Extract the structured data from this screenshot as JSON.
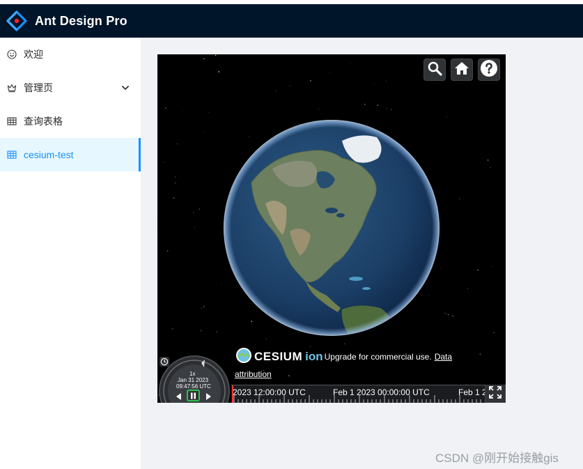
{
  "app": {
    "title": "Ant Design Pro"
  },
  "sidebar": {
    "items": [
      {
        "label": "欢迎",
        "icon": "smile-icon"
      },
      {
        "label": "管理页",
        "icon": "crown-icon",
        "expandable": true
      },
      {
        "label": "查询表格",
        "icon": "table-icon"
      },
      {
        "label": "cesium-test",
        "icon": "table-icon",
        "selected": true
      }
    ]
  },
  "viewer": {
    "toolbar": [
      "search-icon",
      "home-icon",
      "help-icon"
    ],
    "credit": {
      "brand_main": "CESIUM",
      "brand_sub": "ion",
      "upgrade_text": "Upgrade for commercial use.",
      "data_link": "Data",
      "attribution_link": "attribution"
    },
    "animation": {
      "speed": "1x",
      "date": "Jan 31 2023",
      "time": "09:47:56 UTC"
    },
    "timeline": {
      "labels": [
        "2023 12:00:00 UTC",
        "Feb 1 2023 00:00:00 UTC",
        "Feb 1 2"
      ]
    }
  },
  "colors": {
    "header_bg": "#001529",
    "accent": "#1890ff",
    "selected_bg": "#e6f7ff"
  },
  "watermark": "CSDN @刚开始接触gis"
}
